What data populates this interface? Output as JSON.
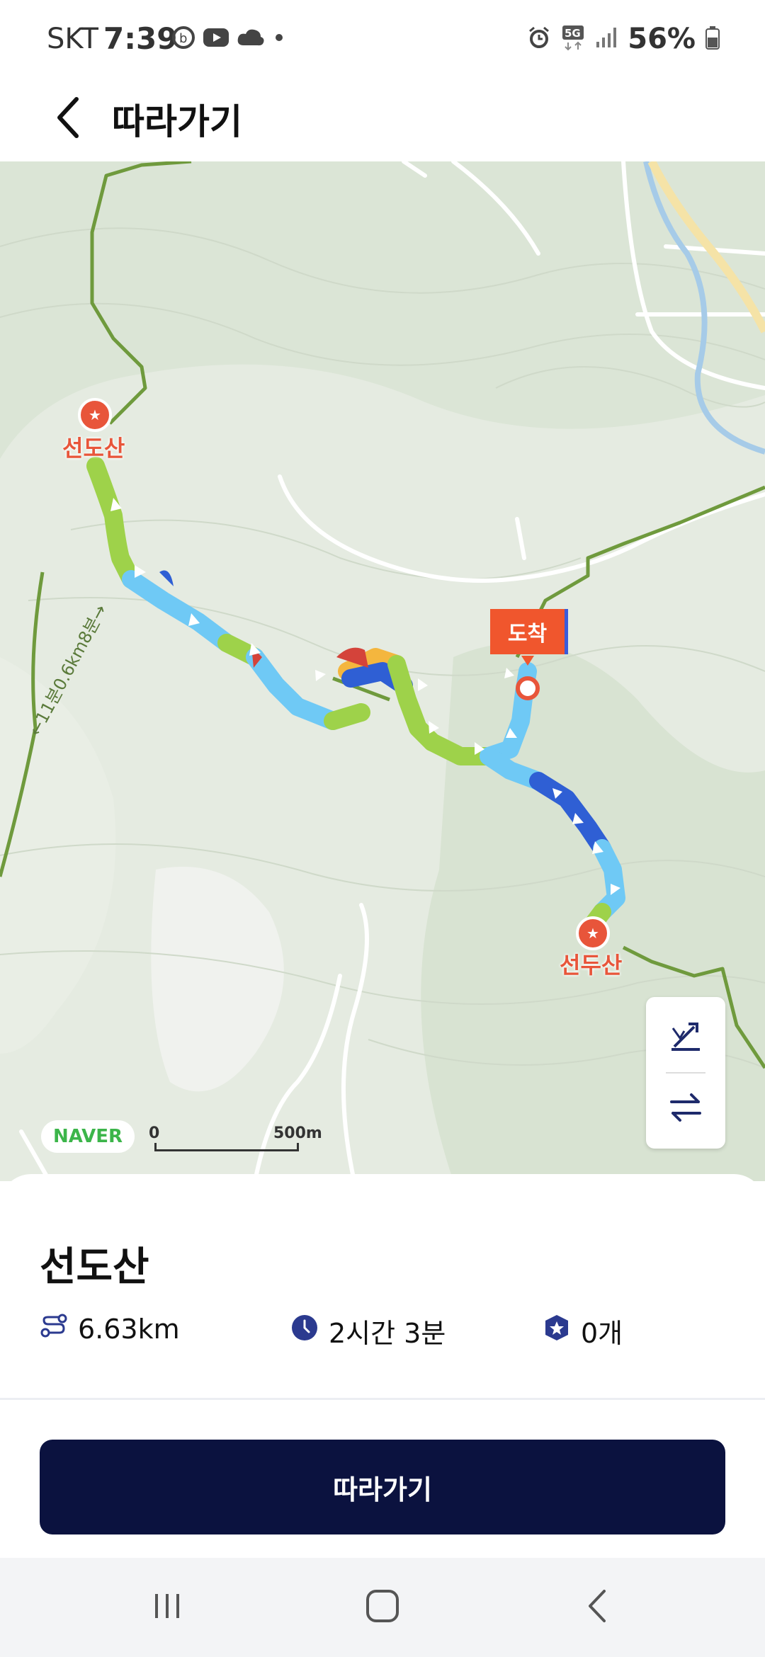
{
  "status_bar": {
    "carrier": "SKT",
    "time": "7:39",
    "battery": "56%",
    "left_icons": [
      "b-app-icon",
      "youtube-icon",
      "cloud-icon",
      "dot-icon"
    ],
    "right_icons": [
      "alarm-icon",
      "5g-icon",
      "signal-icon",
      "battery-icon"
    ]
  },
  "header": {
    "title": "따라가기",
    "back_icon": "chevron-left-icon"
  },
  "map": {
    "start_label": "선도산",
    "end_label": "선두산",
    "arrival_flag": "도착",
    "logo": "NAVER",
    "scale_zero": "0",
    "scale_distance": "500m",
    "trail_annotation": "←11분0.6km8분→",
    "controls": [
      "elevation-icon",
      "swap-direction-icon"
    ]
  },
  "course": {
    "name": "선도산",
    "distance": "6.63km",
    "duration": "2시간 3분",
    "stamps": "0개",
    "distance_icon": "route-icon",
    "duration_icon": "clock-icon",
    "stamps_icon": "stamp-badge-icon"
  },
  "action": {
    "follow_label": "따라가기"
  },
  "nav_bar": {
    "buttons": [
      "recent-apps-icon",
      "home-icon",
      "back-icon"
    ]
  },
  "colors": {
    "primary_button": "#0b123f",
    "accent_orange": "#f0562d",
    "place_red": "#e8553a",
    "route_green": "#9ed24a",
    "route_light_blue": "#6fc9f5",
    "route_blue": "#2f5fd4",
    "route_orange": "#f4b63e",
    "map_bg": "#e6ece2"
  }
}
